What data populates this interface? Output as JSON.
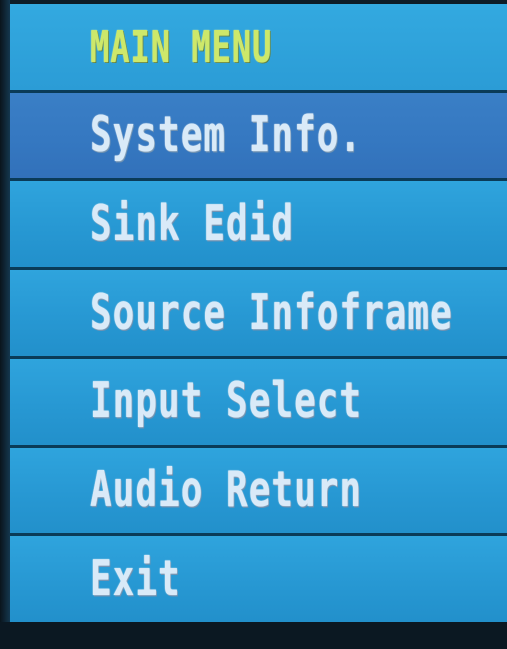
{
  "menu": {
    "title": "MAIN MENU",
    "items": [
      {
        "label": "System Info.",
        "selected": true
      },
      {
        "label": "Sink Edid",
        "selected": false
      },
      {
        "label": "Source Infoframe",
        "selected": false
      },
      {
        "label": "Input Select",
        "selected": false
      },
      {
        "label": "Audio Return",
        "selected": false
      },
      {
        "label": "Exit",
        "selected": false
      }
    ]
  },
  "colors": {
    "panel_blue": "#2a9bd6",
    "selected_row": "#3578c1",
    "title_text": "#cde86a",
    "item_text": "#d9eaf8",
    "divider": "#0a3b58"
  }
}
